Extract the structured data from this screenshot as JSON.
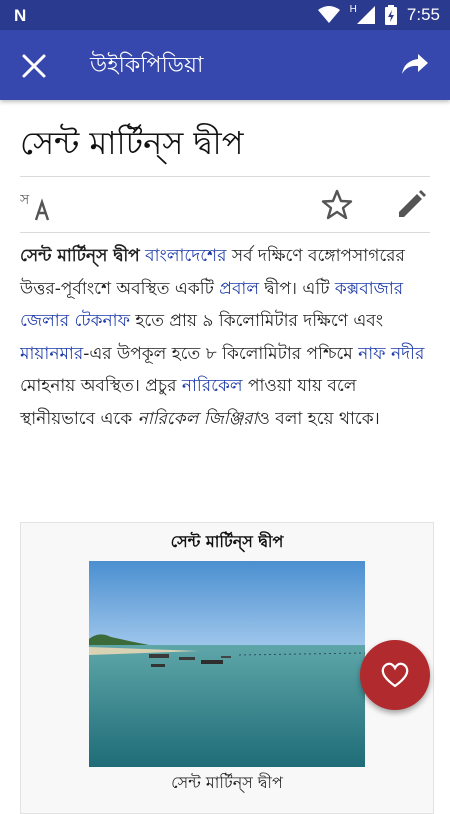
{
  "status_bar": {
    "logo": "N",
    "network_label": "H",
    "time": "7:55",
    "icons": [
      "wifi-icon",
      "signal-icon",
      "battery-icon"
    ]
  },
  "app_bar": {
    "title": "উইকিপিডিয়া",
    "close_icon": "close-icon",
    "share_icon": "share-icon"
  },
  "article": {
    "title": "সেন্ট মার্টিন্‌স দ্বীপ",
    "toolbar_icons": [
      "translate-icon",
      "star-icon",
      "edit-icon"
    ],
    "paragraph": [
      {
        "text": "সেন্ট মার্টিন্‌স দ্বীপ",
        "style": "bold"
      },
      {
        "text": " ",
        "style": "plain"
      },
      {
        "text": "বাংলাদেশের",
        "style": "link"
      },
      {
        "text": " সর্ব দক্ষিণে বঙ্গোপসাগরের উত্তর-পূর্বাংশে অবস্থিত একটি ",
        "style": "plain"
      },
      {
        "text": "প্রবাল",
        "style": "link"
      },
      {
        "text": " দ্বীপ। এটি ",
        "style": "plain"
      },
      {
        "text": "কক্সবাজার জেলার",
        "style": "link"
      },
      {
        "text": " ",
        "style": "plain"
      },
      {
        "text": "টেকনাফ",
        "style": "link"
      },
      {
        "text": " হতে প্রায় ৯ কিলোমিটার দক্ষিণে এবং ",
        "style": "plain"
      },
      {
        "text": "মায়ানমার",
        "style": "link"
      },
      {
        "text": "-এর উপকূল হতে ৮ কিলোমিটার পশ্চিমে ",
        "style": "plain"
      },
      {
        "text": "নাফ নদীর",
        "style": "link"
      },
      {
        "text": " মোহনায় অবস্থিত। প্রচুর ",
        "style": "plain"
      },
      {
        "text": "নারিকেল",
        "style": "link"
      },
      {
        "text": " পাওয়া যায় বলে স্থানীয়ভাবে একে ",
        "style": "plain"
      },
      {
        "text": "নারিকেল জিঞ্জিরা",
        "style": "italic"
      },
      {
        "text": "ও বলা হয়ে থাকে।",
        "style": "plain"
      }
    ]
  },
  "infobox": {
    "title": "সেন্ট মার্টিন্‌স দ্বীপ",
    "caption": "সেন্ট মার্টিন্‌স দ্বীপ"
  },
  "fab": {
    "icon": "heart-icon"
  },
  "colors": {
    "status_bar": "#2a3a8e",
    "app_bar": "#3647ad",
    "link": "#1d3aa8",
    "fab": "#b02a2e"
  }
}
